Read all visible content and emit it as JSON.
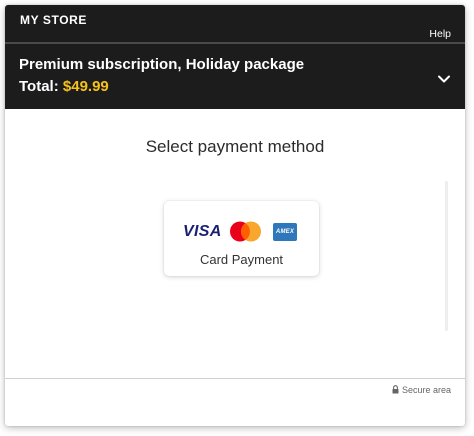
{
  "header": {
    "store_name": "MY STORE",
    "help_label": "Help"
  },
  "order": {
    "title": "Premium subscription, Holiday package",
    "total_label": "Total:",
    "total_amount": "$49.99"
  },
  "payment": {
    "heading": "Select payment method",
    "methods": [
      {
        "label": "Card Payment",
        "brands": [
          "VISA",
          "Mastercard",
          "AMEX"
        ]
      }
    ]
  },
  "footer": {
    "secure_label": "Secure area",
    "lock_icon": "lock-icon"
  },
  "colors": {
    "header_bg": "#1c1c1c",
    "total_accent": "#f6c21c",
    "visa_blue": "#1a1f71",
    "mastercard_red": "#eb001b",
    "mastercard_orange": "#f79e1b",
    "amex_blue": "#2e77bb"
  }
}
